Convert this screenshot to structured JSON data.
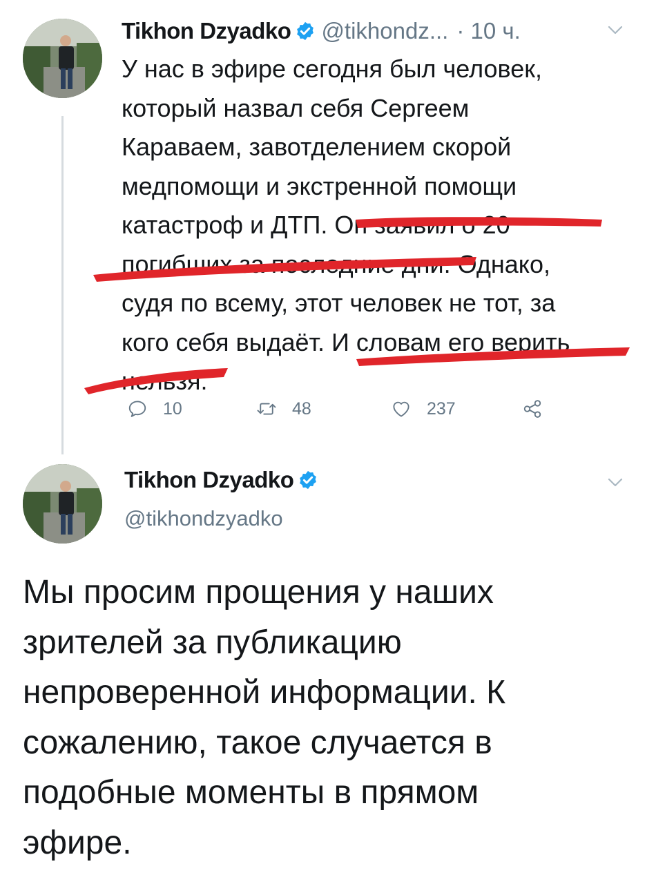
{
  "tweet_1": {
    "author_name": "Tikhon Dzyadko",
    "handle": "@tikhondz...",
    "time": "· 10 ч.",
    "text_lines": [
      "У нас в эфире сегодня был человек,",
      "который назвал себя Сергеем",
      "Караваем, завотделением скорой",
      "медпомощи и экстренной помощи",
      "катастроф и ДТП. Он заявил о 20",
      "погибших за последние дни. Однако,",
      "судя по всему, этот человек не тот, за",
      "кого себя выдаёт. И словам его верить",
      "нельзя."
    ],
    "reply_count": "10",
    "retweet_count": "48",
    "like_count": "237",
    "icons": [
      "verified-badge-icon",
      "chevron-down-icon",
      "reply-icon",
      "retweet-icon",
      "heart-icon",
      "share-icon"
    ]
  },
  "tweet_2": {
    "author_name": "Tikhon Dzyadko",
    "handle": "@tikhondzyadko",
    "text_lines": [
      "Мы просим прощения у наших",
      "зрителей за публикацию",
      "непроверенной информации. К",
      "сожалению, такое случается в",
      "подобные моменты в прямом",
      "эфире."
    ]
  },
  "colors": {
    "text": "#14171a",
    "secondary": "#657786",
    "verified": "#1da1f2",
    "marker": "#e0252a",
    "thread_line": "#d6dbdf"
  }
}
